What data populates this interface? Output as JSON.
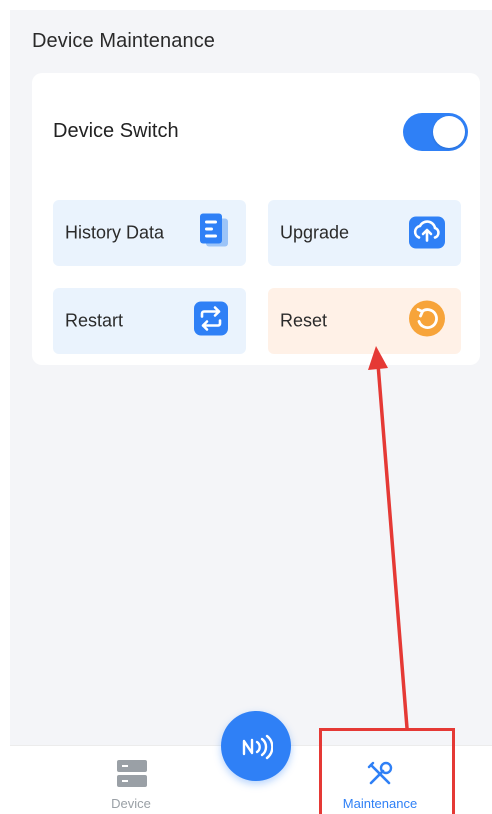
{
  "page": {
    "title": "Device Maintenance"
  },
  "device_switch": {
    "label": "Device Switch",
    "on": true
  },
  "actions": [
    {
      "label": "History Data",
      "icon": "document-icon"
    },
    {
      "label": "Upgrade",
      "icon": "cloud-upload-icon"
    },
    {
      "label": "Restart",
      "icon": "restart-icon"
    },
    {
      "label": "Reset",
      "icon": "reset-icon"
    }
  ],
  "tabbar": {
    "fab_icon": "nfc-icon",
    "tabs": [
      {
        "label": "Device",
        "icon": "server-icon",
        "active": false
      },
      {
        "label": "Maintenance",
        "icon": "tools-icon",
        "active": true
      }
    ]
  },
  "colors": {
    "accent": "#2f80f6",
    "tile_blue_bg": "#eaf3fd",
    "tile_orange_bg": "#fff1e7",
    "reset_orange": "#f7a43a",
    "annotation_red": "#e53935",
    "inactive_gray": "#9aa0a6"
  }
}
